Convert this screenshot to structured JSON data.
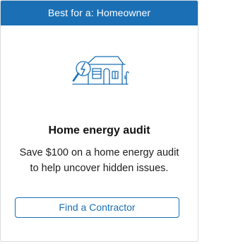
{
  "card": {
    "banner_text": "Best for a: Homeowner",
    "illustration_icon": "house-energy-audit-magnifier-icon",
    "title": "Home energy audit",
    "description": "Save $100 on a home energy audit to help uncover hidden issues.",
    "button_label": "Find a Contractor"
  },
  "colors": {
    "accent": "#1b70b5",
    "banner_text": "#ffffff",
    "body_text": "#1e1e1e",
    "border": "#d9dde0"
  }
}
